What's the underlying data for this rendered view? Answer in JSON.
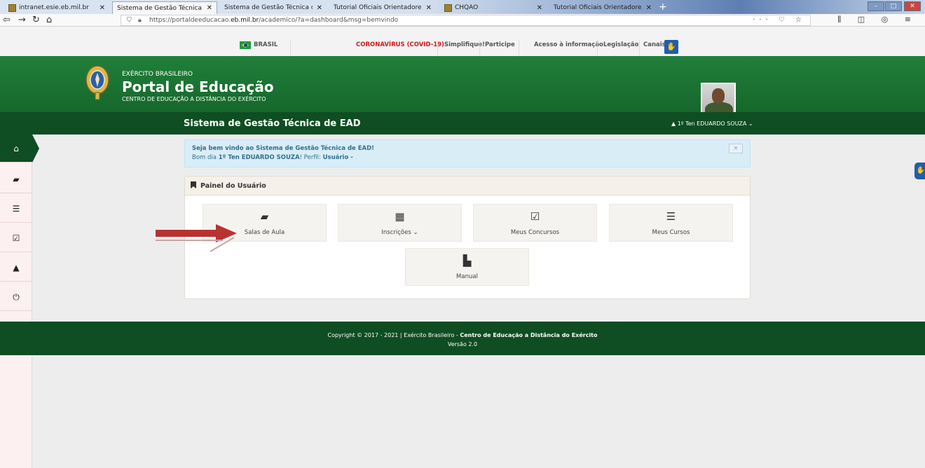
{
  "browser": {
    "tabs": [
      {
        "title": "intranet.esie.eb.mil.br",
        "active": false
      },
      {
        "title": "Sistema de Gestão Técnica de EAD",
        "active": true
      },
      {
        "title": "Sistema de Gestão Técnica de EAD",
        "active": false
      },
      {
        "title": "Tutorial Oficiais Orientadores - CH",
        "active": false
      },
      {
        "title": "CHQAO",
        "active": false
      },
      {
        "title": "Tutorial Oficiais Orientadores - CH",
        "active": false
      }
    ],
    "url_prefix": "https://portaldeeducacao.",
    "url_domain": "eb.mil.br",
    "url_suffix": "/academico/?a=dashboard&msg=bemvindo",
    "url_right_icons": "··· ♡ ☆"
  },
  "govbar": {
    "brasil": "BRASIL",
    "covid": "CORONAVÍRUS (COVID-19)",
    "simplifique": "Simplifique!",
    "participe": "Participe",
    "acesso": "Acesso à informação",
    "legislacao": "Legislação",
    "canais": "Canais"
  },
  "header": {
    "small": "EXÉRCITO BRASILEIRO",
    "title": "Portal de Educação",
    "subtitle": "CENTRO DE EDUCAÇÃO A DISTÂNCIA DO EXÉRCITO",
    "system_title": "Sistema de Gestão Técnica de EAD",
    "user": "▲ 1º Ten EDUARDO SOUZA ⌄"
  },
  "alert": {
    "line1": "Seja bem vindo ao Sistema de Gestão Técnica de EAD!",
    "greeting": "Bom dia ",
    "user": "1º Ten EDUARDO SOUZA",
    "profile_label": "! Perfil: ",
    "profile": "Usuário -",
    "close": "×"
  },
  "panel": {
    "title": "Painel do Usuário",
    "tiles": [
      {
        "label": "Salas de Aula",
        "icon": "book-icon"
      },
      {
        "label": "Inscrições ⌄",
        "icon": "th-icon"
      },
      {
        "label": "Meus Concursos",
        "icon": "check-square-icon"
      },
      {
        "label": "Meus Cursos",
        "icon": "list-icon"
      },
      {
        "label": "Manual",
        "icon": "file-icon"
      }
    ]
  },
  "footer": {
    "copyright": "Copyright © 2017 - 2021 | Exército Brasileiro - ",
    "org": "Centro de Educação a Distância do Exército",
    "version": "Versão 2.0"
  },
  "colors": {
    "header_green": "#16672b",
    "dark_green": "#0f4d22",
    "alert_bg": "#d9edf7",
    "arrow_red": "#b83232"
  }
}
